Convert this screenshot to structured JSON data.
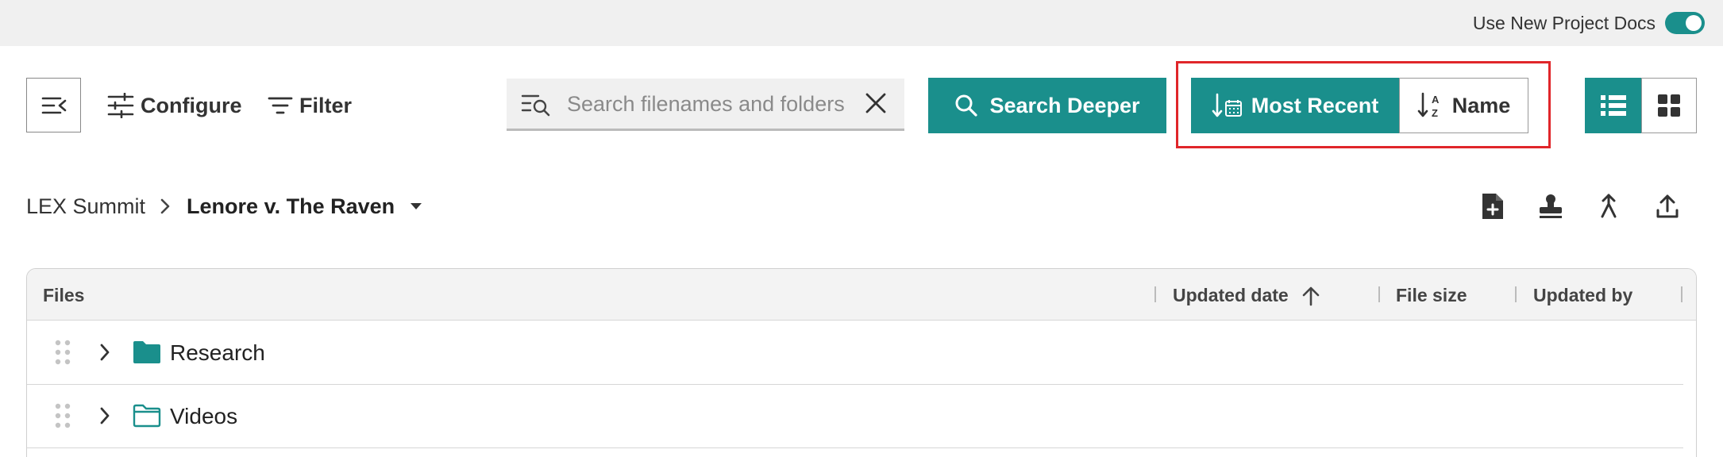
{
  "topbar": {
    "toggle_label": "Use New Project Docs",
    "toggle_on": true
  },
  "toolbar": {
    "configure_label": "Configure",
    "filter_label": "Filter",
    "search_placeholder": "Search filenames and folders",
    "search_deeper_label": "Search Deeper",
    "sort_recent_label": "Most Recent",
    "sort_name_label": "Name",
    "sort_active": "Most Recent",
    "view_active": "list"
  },
  "breadcrumb": {
    "parent": "LEX Summit",
    "current": "Lenore v. The Raven"
  },
  "table": {
    "columns": {
      "files": "Files",
      "updated_date": "Updated date",
      "file_size": "File size",
      "updated_by": "Updated by"
    },
    "rows": [
      {
        "name": "Research",
        "icon": "folder-filled-icon"
      },
      {
        "name": "Videos",
        "icon": "folder-outline-icon"
      }
    ]
  },
  "colors": {
    "accent": "#1a8f8c",
    "highlight": "#e0262a",
    "topbar_bg": "#f0f0f0"
  }
}
